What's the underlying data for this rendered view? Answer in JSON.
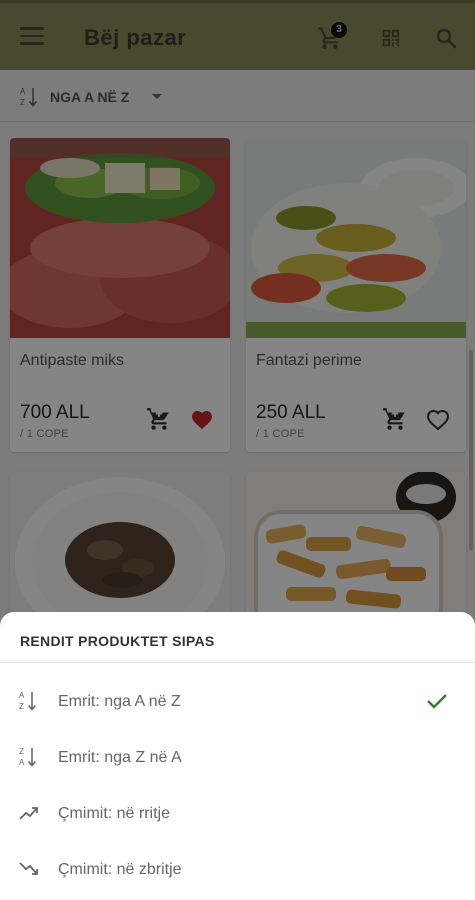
{
  "header": {
    "title": "Bëj pazar",
    "cart_count": "3",
    "icons": [
      "menu-icon",
      "cart-icon",
      "qr-code-icon",
      "search-icon"
    ]
  },
  "sort_bar": {
    "label": "NGA A NË Z",
    "icon": "sort-az-icon"
  },
  "products": [
    {
      "name": "Antipaste miks",
      "price": "700 ALL",
      "unit": "/ 1 COPE",
      "favorite": true
    },
    {
      "name": "Fantazi perime",
      "price": "250 ALL",
      "unit": "/ 1 COPE",
      "favorite": false
    },
    {
      "name": "",
      "price": "",
      "unit": "",
      "favorite": false
    },
    {
      "name": "",
      "price": "",
      "unit": "",
      "favorite": false
    }
  ],
  "sort_sheet": {
    "title": "RENDIT PRODUKTET SIPAS",
    "options": [
      {
        "label": "Emrit: nga A në Z",
        "icon": "sort-az-icon",
        "selected": true
      },
      {
        "label": "Emrit: nga Z në A",
        "icon": "sort-za-icon",
        "selected": false
      },
      {
        "label": "Çmimit: në rritje",
        "icon": "trending-up-icon",
        "selected": false
      },
      {
        "label": "Çmimit: në zbritje",
        "icon": "trending-down-icon",
        "selected": false
      }
    ]
  },
  "colors": {
    "header_bg": "#8a8c5a",
    "favorite_red": "#c62828",
    "check_green": "#2e7d32"
  }
}
